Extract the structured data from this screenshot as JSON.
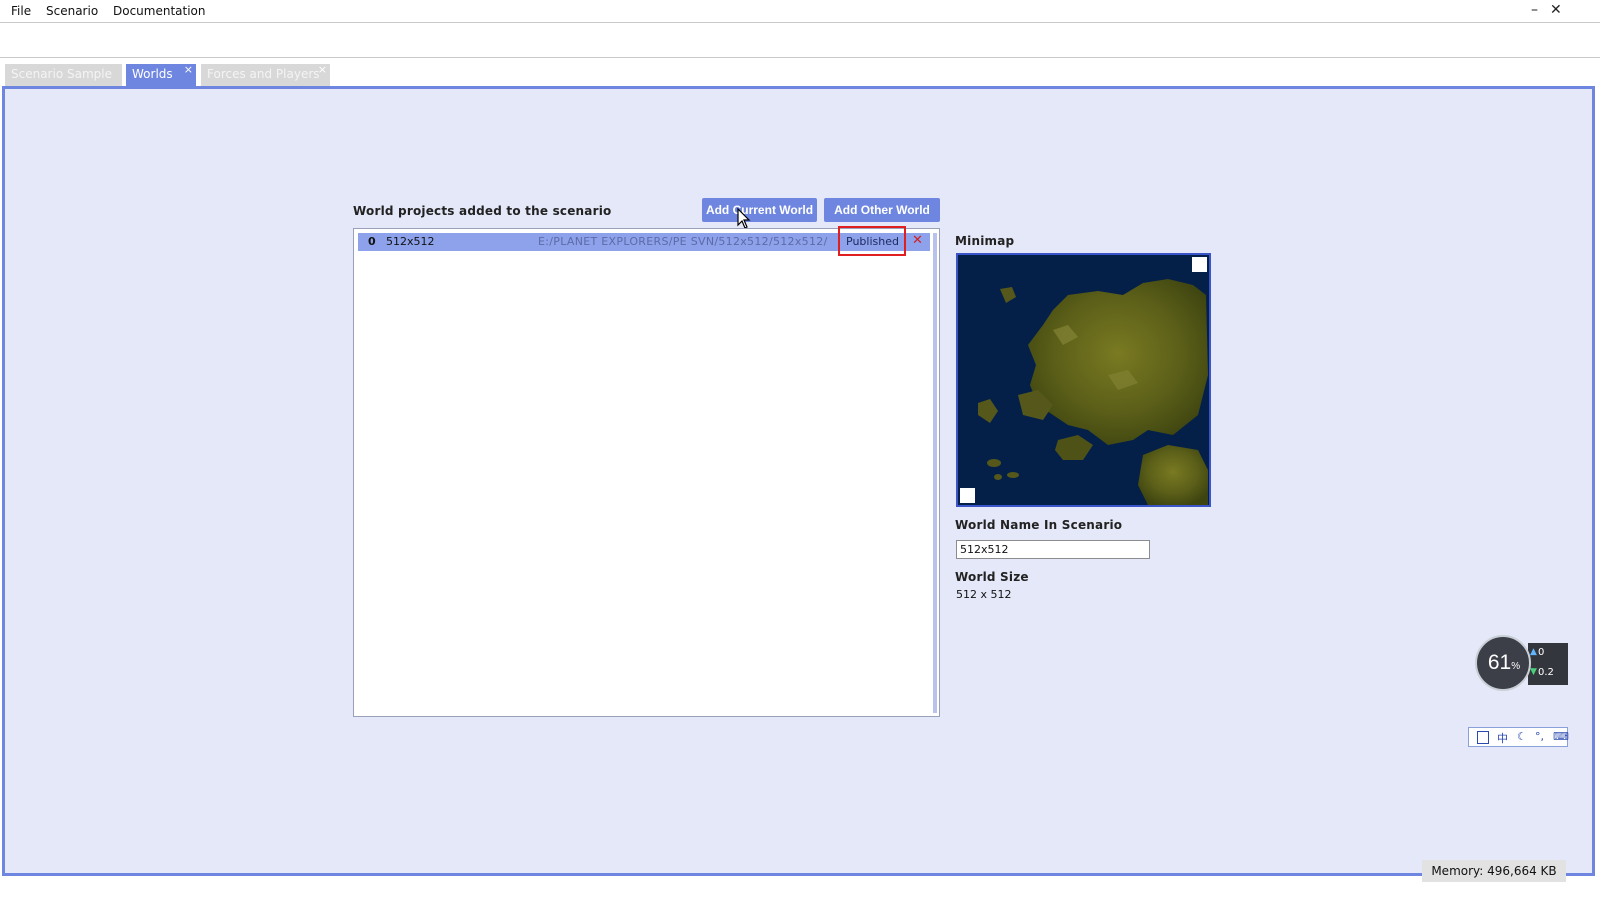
{
  "menu": {
    "items": [
      "File",
      "Scenario",
      "Documentation"
    ],
    "minimize": "–",
    "close": "✕"
  },
  "tabs": [
    {
      "label": "Scenario Sample",
      "active": false
    },
    {
      "label": "Worlds",
      "active": true,
      "close": "×"
    },
    {
      "label": "Forces and Players",
      "active": false,
      "close": "×"
    }
  ],
  "worlds_panel": {
    "list_title": "World projects added to the scenario",
    "add_current_label": "Add Current World",
    "add_other_label": "Add Other World",
    "rows": [
      {
        "index": "0",
        "name": "512x512",
        "path": "E:/PLANET EXPLORERS/PE SVN/512x512/512x512/",
        "status": "Published",
        "remove": "✕"
      }
    ]
  },
  "minimap": {
    "label": "Minimap"
  },
  "world_name": {
    "label": "World Name In Scenario",
    "value": "512x512"
  },
  "world_size": {
    "label": "World Size",
    "value": "512 x 512"
  },
  "cpu_widget": {
    "percent": "61",
    "unit": "%",
    "up": "0",
    "down": "0.2"
  },
  "ime": {
    "chinese": "中"
  },
  "status": {
    "memory": "Memory: 496,664 KB"
  },
  "colors": {
    "accent": "#6e86e0",
    "panel_bg": "#e4e8f8",
    "selection": "#8da2ea",
    "highlight": "#e02020",
    "minimap_water": "#052048"
  }
}
